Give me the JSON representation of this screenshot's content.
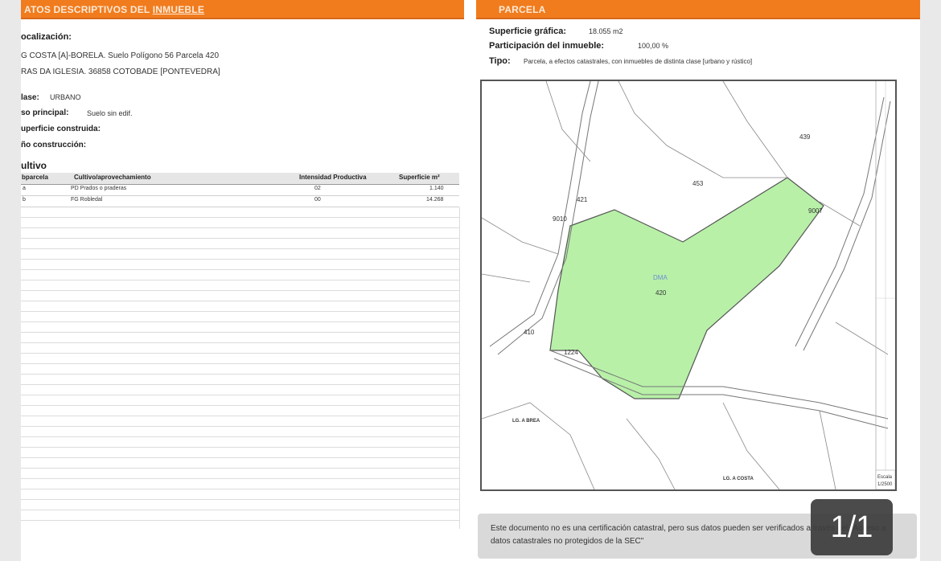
{
  "left": {
    "header": {
      "title_prefix": "ATOS DESCRIPTIVOS DEL ",
      "title_underlined": "INMUEBLE"
    },
    "localizacion": {
      "label": "ocalización:",
      "line1": "G COSTA [A]-BORELA. Suelo Polígono 56 Parcela 420",
      "line2": "RAS DA IGLESIA. 36858 COTOBADE [PONTEVEDRA]"
    },
    "clase": {
      "label": "lase:",
      "value": "URBANO"
    },
    "uso": {
      "label": "so principal:",
      "value": "Suelo sin edif."
    },
    "superficie_construida": {
      "label": "uperficie construida:"
    },
    "anio": {
      "label": "ño construcción:"
    },
    "cultivo": {
      "label": "ultivo",
      "headers": [
        "bparcela",
        "Cultivo/aprovechamiento",
        "Intensidad Productiva",
        "Superficie m²"
      ],
      "rows": [
        {
          "sub": "a",
          "cultivo": "PD Prados o praderas",
          "intensidad": "02",
          "superficie": "1.140"
        },
        {
          "sub": "b",
          "cultivo": "FG Robledal",
          "intensidad": "00",
          "superficie": "14.268"
        }
      ]
    }
  },
  "right": {
    "header": {
      "title": "PARCELA"
    },
    "superficie_grafica": {
      "label": "Superficie gráfica:",
      "value": "18.055 m2"
    },
    "participacion": {
      "label": "Participación del inmueble:",
      "value": "100,00 %"
    },
    "tipo": {
      "label": "Tipo:",
      "value": "Parcela, a efectos catastrales, con inmuebles de distinta clase [urbano y rústico]"
    },
    "map": {
      "parcel_color": "#b8f0a8",
      "labels": {
        "p439": "439",
        "p453": "453",
        "p421": "421",
        "p9010": "9010",
        "p9007": "9007",
        "p420": "420",
        "p420b": "DMA",
        "p410": "410",
        "p1224": "1224",
        "place1": "LG. A BREA",
        "place2": "LG. A COSTA",
        "scale": "Escala",
        "scale_val": "1/2500"
      }
    },
    "note": "Este documento no es una certificación catastral, pero sus datos pueden ser verificados a través del \"Acceso a datos catastrales no protegidos de la SEC\""
  },
  "pager": {
    "text": "1/1"
  }
}
